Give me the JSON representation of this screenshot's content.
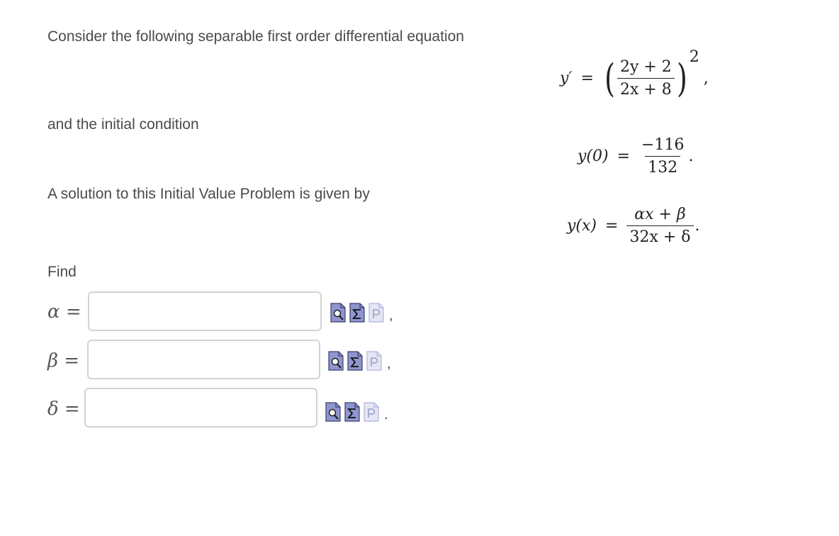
{
  "intro_text": "Consider the following separable first order differential equation",
  "initial_text": "and the initial condition",
  "solution_text": "A solution to this Initial Value Problem is given by",
  "find_text": "Find",
  "ode": {
    "lhs": "y′",
    "equals": "=",
    "numerator": "2y + 2",
    "denominator": "2x + 8",
    "exponent": "2",
    "trailing": ","
  },
  "initial_condition": {
    "lhs": "y(0)",
    "equals": "=",
    "numerator": "−116",
    "denominator": "132",
    "trailing": "."
  },
  "solution": {
    "lhs": "y(x)",
    "equals": "=",
    "numerator": "αx + β",
    "denominator": "32x + δ",
    "trailing": "."
  },
  "answers": [
    {
      "symbol": "α =",
      "value": "",
      "placeholder": "",
      "trailing": ","
    },
    {
      "symbol": "β =",
      "value": "",
      "placeholder": "",
      "trailing": ","
    },
    {
      "symbol": "δ =",
      "value": "",
      "placeholder": "",
      "trailing": "."
    }
  ],
  "icons": [
    "preview-icon",
    "equation-editor-icon",
    "parser-help-icon"
  ],
  "colors": {
    "icon_active": "#6b74b8",
    "icon_inactive": "#c9cce6",
    "field_border": "#d3d3d3",
    "text": "#4a4a4a"
  }
}
